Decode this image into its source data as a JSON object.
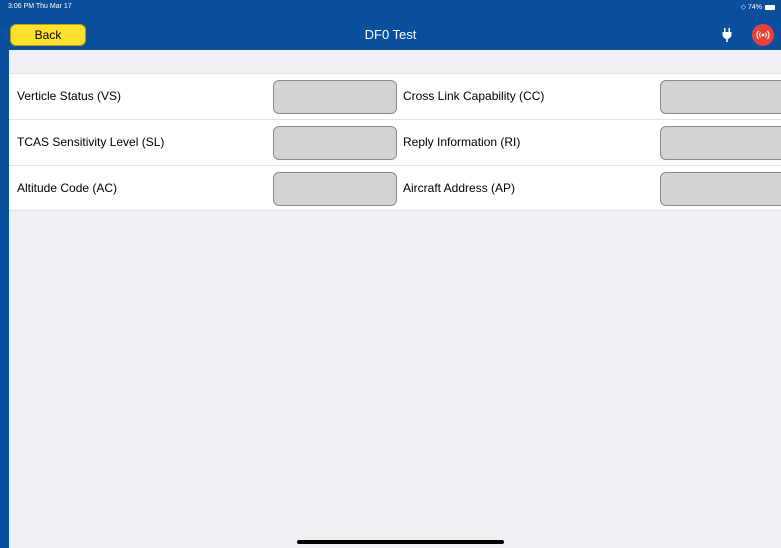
{
  "status_bar": {
    "time": "3:06 PM  Thu Mar 17",
    "battery": "74%"
  },
  "header": {
    "back_label": "Back",
    "title": "DF0 Test"
  },
  "colors": {
    "header_bg": "#0a4f9c",
    "back_button": "#ffe12e",
    "broadcast_button": "#e8413a"
  },
  "rows": [
    {
      "left_label": "Verticle Status (VS)",
      "left_value": "",
      "right_label": "Cross Link Capability (CC)",
      "right_value": ""
    },
    {
      "left_label": "TCAS Sensitivity Level (SL)",
      "left_value": "",
      "right_label": "Reply Information (RI)",
      "right_value": ""
    },
    {
      "left_label": "Altitude Code (AC)",
      "left_value": "",
      "right_label": "Aircraft Address (AP)",
      "right_value": ""
    }
  ],
  "icons": {
    "plug": "plug-icon",
    "broadcast": "broadcast-icon",
    "wifi": "wifi-icon",
    "battery": "battery-icon"
  }
}
